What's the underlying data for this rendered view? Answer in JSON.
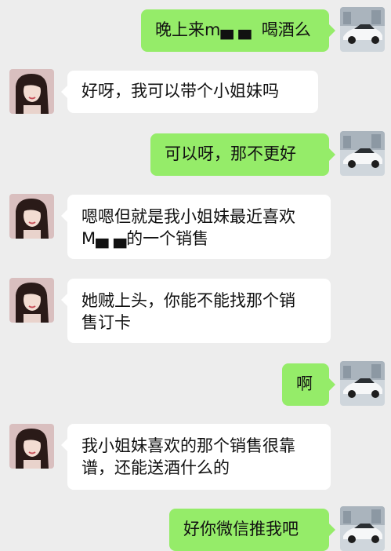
{
  "colors": {
    "background": "#ededed",
    "incoming_bubble": "#ffffff",
    "outgoing_bubble": "#95ec69",
    "text": "#111111"
  },
  "messages": [
    {
      "sender": "me",
      "text": "晚上来m▄ ▄  喝酒么",
      "avatar": "white-sports-car-avatar"
    },
    {
      "sender": "contact",
      "text": "好呀，我可以带个小姐妹吗",
      "avatar": "woman-photo-avatar"
    },
    {
      "sender": "me",
      "text": "可以呀，那不更好",
      "avatar": "white-sports-car-avatar"
    },
    {
      "sender": "contact",
      "text": "嗯嗯但就是我小姐妹最近喜欢\nM▄ ▄的一个销售",
      "avatar": "woman-photo-avatar"
    },
    {
      "sender": "contact",
      "text": "她贼上头，你能不能找那个销\n售订卡",
      "avatar": "woman-photo-avatar"
    },
    {
      "sender": "me",
      "text": "啊",
      "avatar": "white-sports-car-avatar"
    },
    {
      "sender": "contact",
      "text": "我小姐妹喜欢的那个销售很靠\n谱，还能送酒什么的",
      "avatar": "woman-photo-avatar"
    },
    {
      "sender": "me",
      "text": "好你微信推我吧",
      "avatar": "white-sports-car-avatar"
    }
  ]
}
